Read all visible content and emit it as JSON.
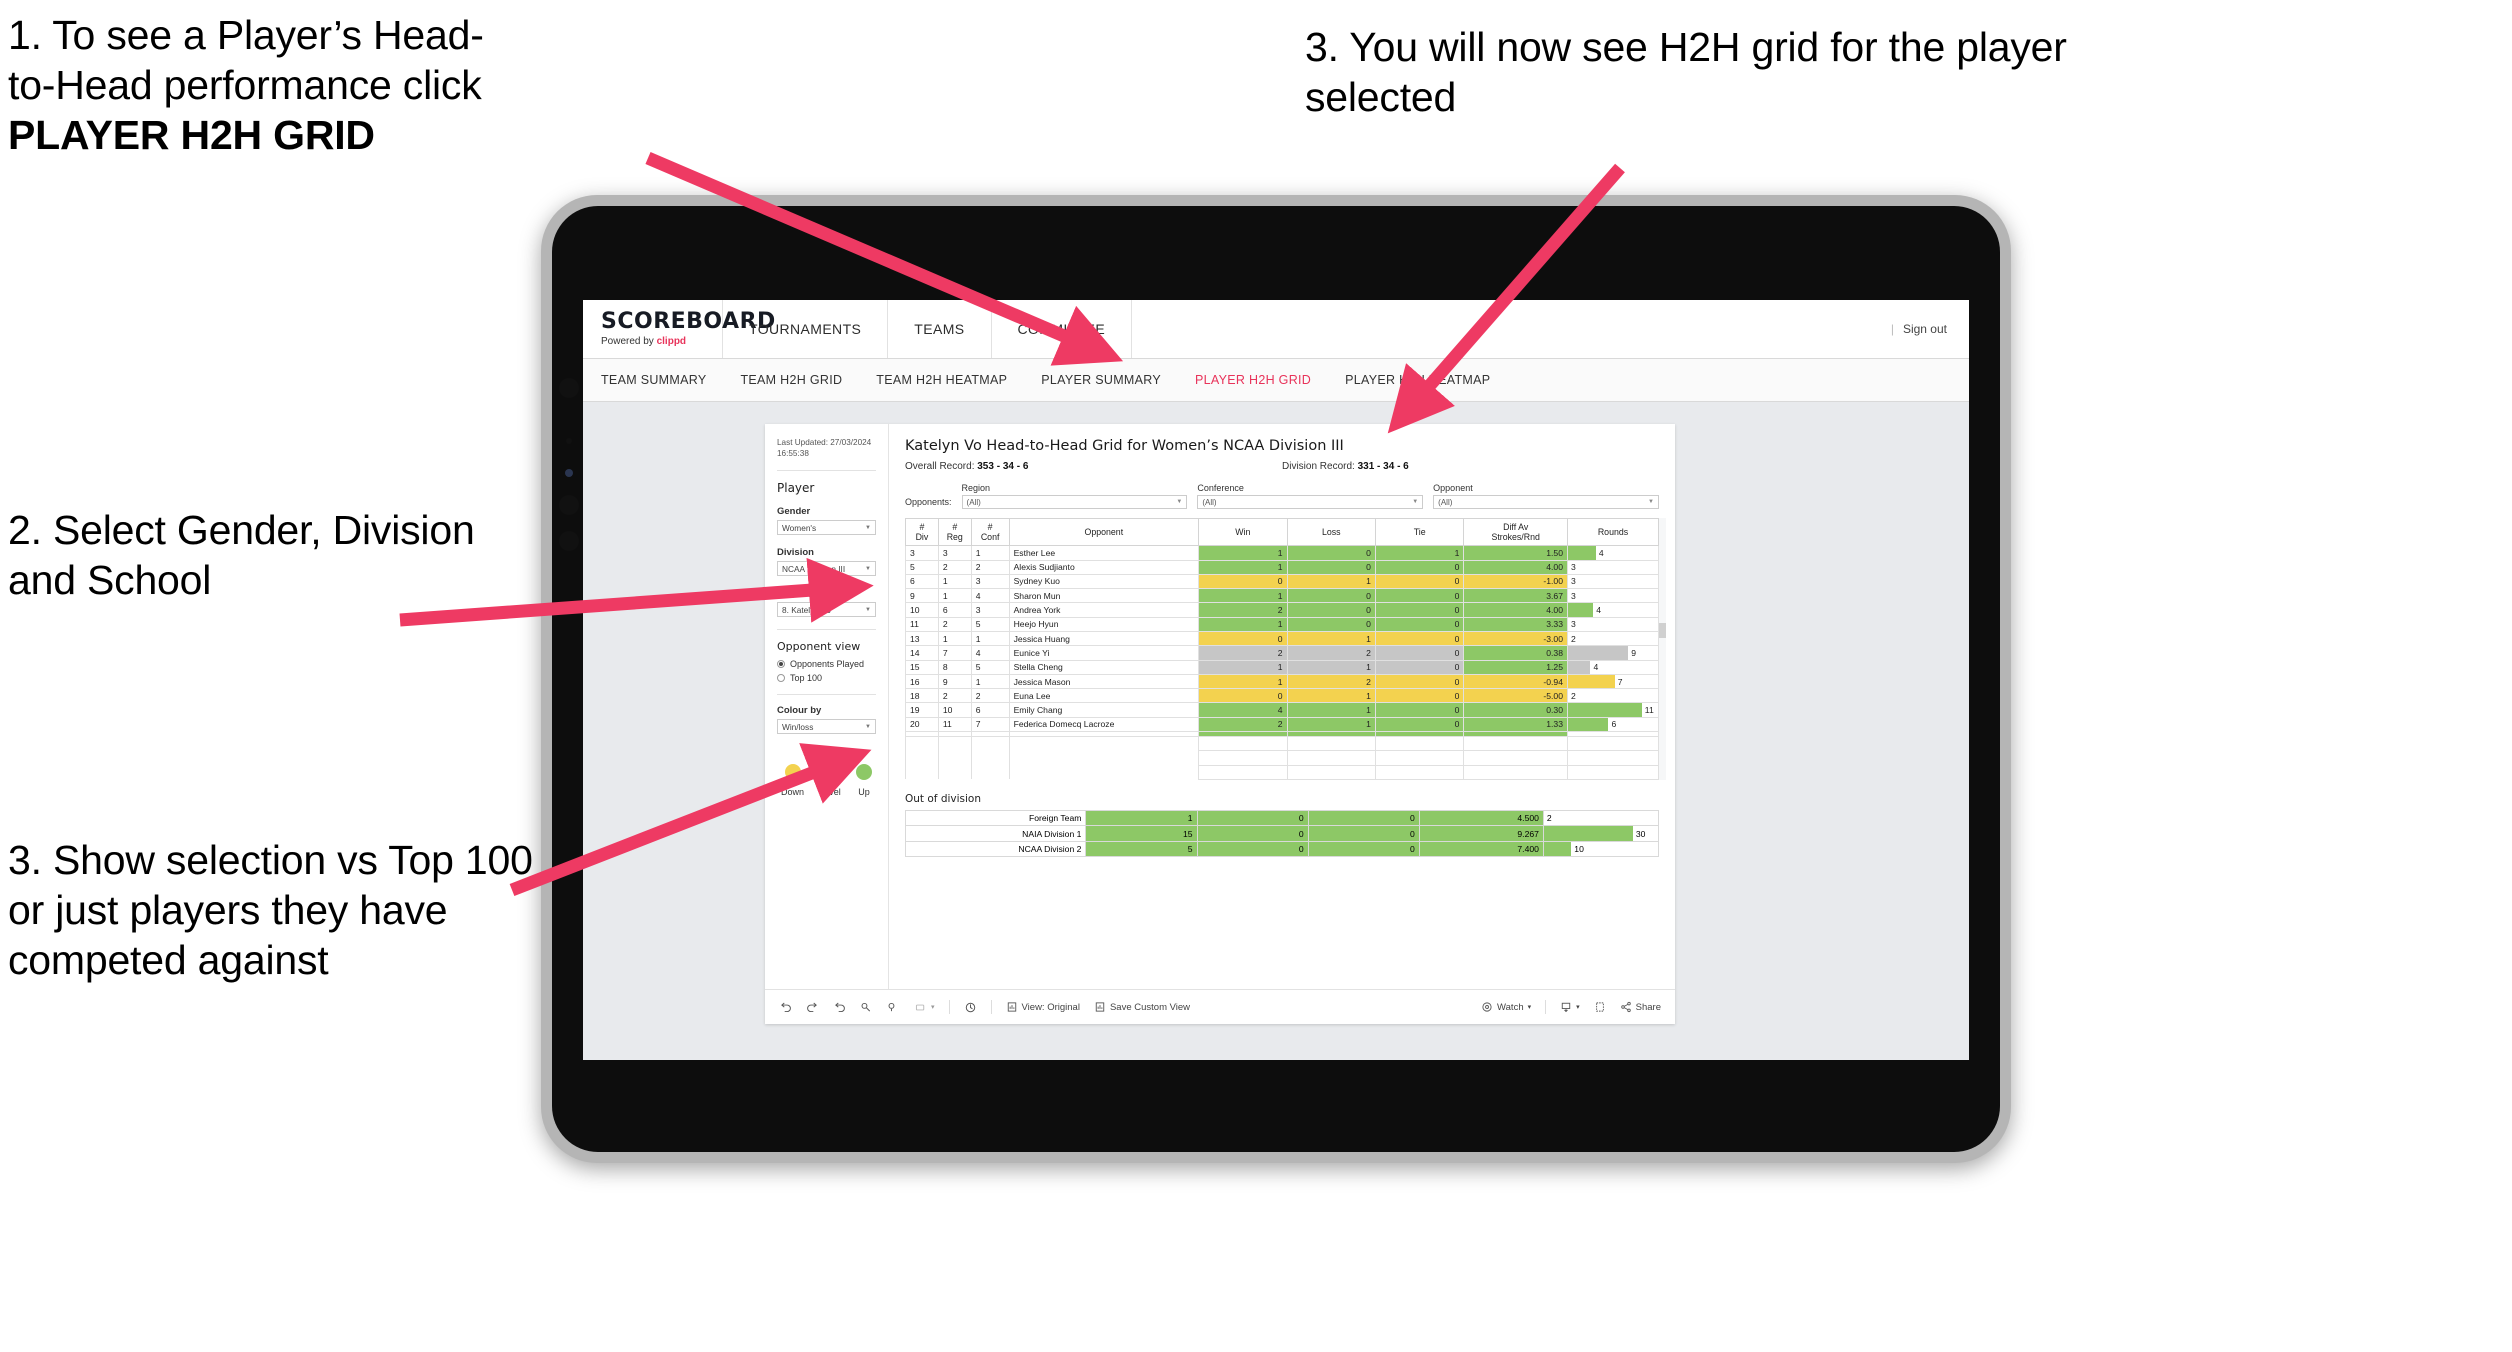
{
  "annotations": {
    "step1_line1": "1. To see a Player’s Head-",
    "step1_line2": "to-Head performance click",
    "step1_bold": "PLAYER H2H GRID",
    "step2": "2. Select Gender, Division and School",
    "step3_left": "3. Show selection vs Top 100 or just players they have competed against",
    "step3_right": "3. You will now see H2H grid for the player selected"
  },
  "colors": {
    "accent_pink": "#ee3a63",
    "brand_red": "#e8335a",
    "green": "#8dc866",
    "yellow": "#f3d24f",
    "grey": "#c6c6c6"
  },
  "app": {
    "brand_name": "SCOREBOARD",
    "brand_sub_prefix": "Powered by ",
    "brand_sub_accent": "clippd",
    "header_nav": [
      "TOURNAMENTS",
      "TEAMS",
      "COMMITTEE"
    ],
    "header_right_sep": "|",
    "sign_out": "Sign out",
    "tabs": [
      {
        "label": "TEAM SUMMARY",
        "active": false
      },
      {
        "label": "TEAM H2H GRID",
        "active": false
      },
      {
        "label": "TEAM H2H HEATMAP",
        "active": false
      },
      {
        "label": "PLAYER SUMMARY",
        "active": false
      },
      {
        "label": "PLAYER H2H GRID",
        "active": true
      },
      {
        "label": "PLAYER H2H HEATMAP",
        "active": false
      }
    ]
  },
  "controls": {
    "last_updated": "Last Updated: 27/03/2024 16:55:38",
    "player_heading": "Player",
    "gender_label": "Gender",
    "gender_value": "Women's",
    "division_label": "Division",
    "division_value": "NCAA Division III",
    "player_rank_label": "Player (Rank)",
    "player_rank_value": "8. Katelyn Vo",
    "opponent_view_heading": "Opponent view",
    "opponent_view_options": [
      {
        "label": "Opponents Played",
        "selected": true
      },
      {
        "label": "Top 100",
        "selected": false
      }
    ],
    "colour_by_label": "Colour by",
    "colour_by_value": "Win/loss",
    "legend": [
      {
        "label": "Down",
        "color": "#f3d24f"
      },
      {
        "label": "Level",
        "color": "#c6c6c6"
      },
      {
        "label": "Up",
        "color": "#8dc866"
      }
    ]
  },
  "viz": {
    "title": "Katelyn Vo Head-to-Head Grid for Women’s NCAA Division III",
    "overall_record_label": "Overall Record: ",
    "overall_record_value": "353 -  34 - 6",
    "division_record_label": "Division Record: ",
    "division_record_value": "331 -  34 - 6",
    "opponents_label": "Opponents:",
    "filters": [
      {
        "label": "Region",
        "value": "(All)"
      },
      {
        "label": "Conference",
        "value": "(All)"
      },
      {
        "label": "Opponent",
        "value": "(All)"
      }
    ],
    "columns": [
      "# Div",
      "# Reg",
      "# Conf",
      "Opponent",
      "Win",
      "Loss",
      "Tie",
      "Diff Av Strokes/Rnd",
      "Rounds"
    ],
    "out_of_division_title": "Out of division"
  },
  "chart_data": {
    "type": "table",
    "title": "Katelyn Vo Head-to-Head Grid for Women’s NCAA Division III",
    "columns": [
      "# Div",
      "# Reg",
      "# Conf",
      "Opponent",
      "Win",
      "Loss",
      "Tie",
      "Diff Av Strokes/Rnd",
      "Rounds"
    ],
    "rows": [
      {
        "div": "3",
        "reg": "3",
        "conf": "1",
        "opponent": "Esther Lee",
        "win": "1",
        "loss": "0",
        "tie": "1",
        "diff": "1.50",
        "rounds": "4",
        "rounds_pct": 31,
        "color": "#8dc866"
      },
      {
        "div": "5",
        "reg": "2",
        "conf": "2",
        "opponent": "Alexis Sudjianto",
        "win": "1",
        "loss": "0",
        "tie": "0",
        "diff": "4.00",
        "rounds": "3",
        "rounds_pct": 0,
        "color": "#8dc866"
      },
      {
        "div": "6",
        "reg": "1",
        "conf": "3",
        "opponent": "Sydney Kuo",
        "win": "0",
        "loss": "1",
        "tie": "0",
        "diff": "-1.00",
        "rounds": "3",
        "rounds_pct": 0,
        "color": "#f3d24f"
      },
      {
        "div": "9",
        "reg": "1",
        "conf": "4",
        "opponent": "Sharon Mun",
        "win": "1",
        "loss": "0",
        "tie": "0",
        "diff": "3.67",
        "rounds": "3",
        "rounds_pct": 0,
        "color": "#8dc866"
      },
      {
        "div": "10",
        "reg": "6",
        "conf": "3",
        "opponent": "Andrea York",
        "win": "2",
        "loss": "0",
        "tie": "0",
        "diff": "4.00",
        "rounds": "4",
        "rounds_pct": 28,
        "color": "#8dc866"
      },
      {
        "div": "11",
        "reg": "2",
        "conf": "5",
        "opponent": "Heejo Hyun",
        "win": "1",
        "loss": "0",
        "tie": "0",
        "diff": "3.33",
        "rounds": "3",
        "rounds_pct": 0,
        "color": "#8dc866"
      },
      {
        "div": "13",
        "reg": "1",
        "conf": "1",
        "opponent": "Jessica Huang",
        "win": "0",
        "loss": "1",
        "tie": "0",
        "diff": "-3.00",
        "rounds": "2",
        "rounds_pct": 0,
        "color": "#f3d24f"
      },
      {
        "div": "14",
        "reg": "7",
        "conf": "4",
        "opponent": "Eunice Yi",
        "win": "2",
        "loss": "2",
        "tie": "0",
        "diff": "0.38",
        "rounds": "9",
        "rounds_pct": 67,
        "color": "#c6c6c6",
        "diff_color": "#8dc866"
      },
      {
        "div": "15",
        "reg": "8",
        "conf": "5",
        "opponent": "Stella Cheng",
        "win": "1",
        "loss": "1",
        "tie": "0",
        "diff": "1.25",
        "rounds": "4",
        "rounds_pct": 25,
        "color": "#c6c6c6",
        "diff_color": "#8dc866"
      },
      {
        "div": "16",
        "reg": "9",
        "conf": "1",
        "opponent": "Jessica Mason",
        "win": "1",
        "loss": "2",
        "tie": "0",
        "diff": "-0.94",
        "rounds": "7",
        "rounds_pct": 52,
        "color": "#f3d24f"
      },
      {
        "div": "18",
        "reg": "2",
        "conf": "2",
        "opponent": "Euna Lee",
        "win": "0",
        "loss": "1",
        "tie": "0",
        "diff": "-5.00",
        "rounds": "2",
        "rounds_pct": 0,
        "color": "#f3d24f"
      },
      {
        "div": "19",
        "reg": "10",
        "conf": "6",
        "opponent": "Emily Chang",
        "win": "4",
        "loss": "1",
        "tie": "0",
        "diff": "0.30",
        "rounds": "11",
        "rounds_pct": 82,
        "color": "#8dc866"
      },
      {
        "div": "20",
        "reg": "11",
        "conf": "7",
        "opponent": "Federica Domecq Lacroze",
        "win": "2",
        "loss": "1",
        "tie": "0",
        "diff": "1.33",
        "rounds": "6",
        "rounds_pct": 45,
        "color": "#8dc866"
      }
    ],
    "out_of_division": [
      {
        "label": "Foreign Team",
        "win": "1",
        "loss": "0",
        "tie": "0",
        "diff": "4.500",
        "rounds": "2",
        "rounds_pct": 0,
        "color": "#8dc866"
      },
      {
        "label": "NAIA Division 1",
        "win": "15",
        "loss": "0",
        "tie": "0",
        "diff": "9.267",
        "rounds": "30",
        "rounds_pct": 78,
        "color": "#8dc866"
      },
      {
        "label": "NCAA Division 2",
        "win": "5",
        "loss": "0",
        "tie": "0",
        "diff": "7.400",
        "rounds": "10",
        "rounds_pct": 24,
        "color": "#8dc866"
      }
    ]
  },
  "toolbar": {
    "view_label": "View: Original",
    "save_label": "Save Custom View",
    "watch_label": "Watch",
    "share_label": "Share",
    "caret": "▾"
  }
}
